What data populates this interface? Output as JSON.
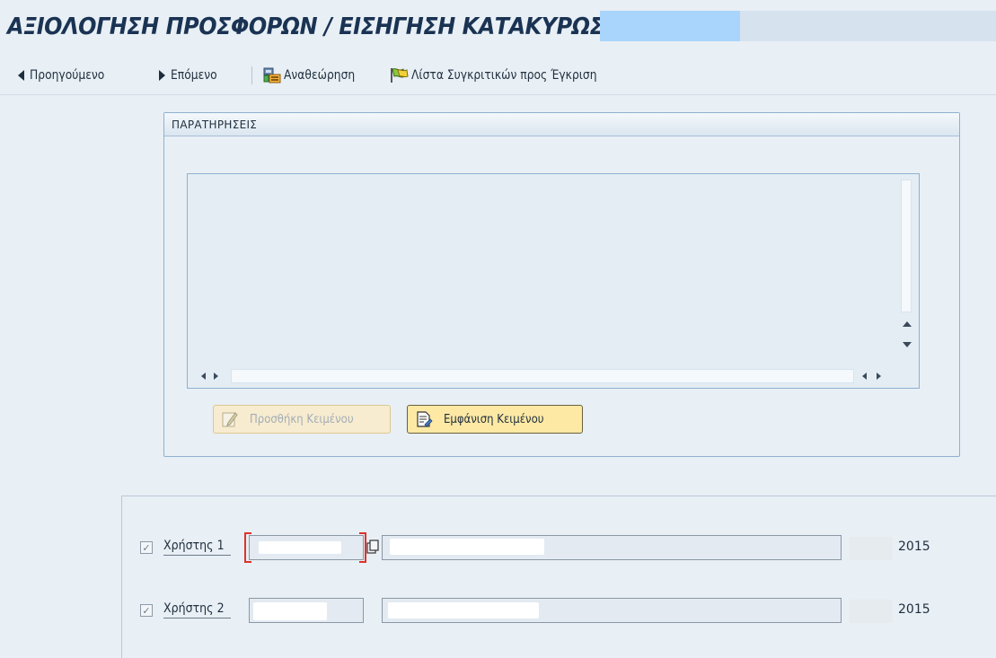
{
  "title": {
    "text": "ΑΞΙΟΛΟΓΗΣΗ ΠΡΟΣΦΟΡΩΝ / ΕΙΣΗΓΗΣΗ ΚΑΤΑΚΥΡΩΣΗΣ -"
  },
  "toolbar": {
    "previous_label": "Προηγούμενο",
    "next_label": "Επόμενο",
    "review_label": "Αναθεώρηση",
    "list_label": "Λίστα Συγκριτικών προς Έγκριση"
  },
  "remarks": {
    "header": "ΠΑΡΑΤΗΡΗΣΕΙΣ",
    "text": "",
    "add_text_label": "Προσθήκη Κειμένου",
    "show_text_label": "Εμφάνιση Κειμένου"
  },
  "users": [
    {
      "label": "Χρήστης 1",
      "checked": true,
      "year": "2015"
    },
    {
      "label": "Χρήστης 2",
      "checked": true,
      "year": "2015"
    }
  ],
  "colors": {
    "background": "#e8eff5",
    "title": "#1a3353",
    "redaction_blue": "#a9d4fb",
    "button_active": "#fde9a4",
    "focus_red": "#e0322a"
  },
  "icons": [
    "triangle-left-icon",
    "triangle-right-icon",
    "review-icon",
    "flag-icon",
    "pencil-icon",
    "document-icon",
    "copy-icon",
    "checkbox-icon",
    "scroll-up-icon",
    "scroll-down-icon"
  ]
}
